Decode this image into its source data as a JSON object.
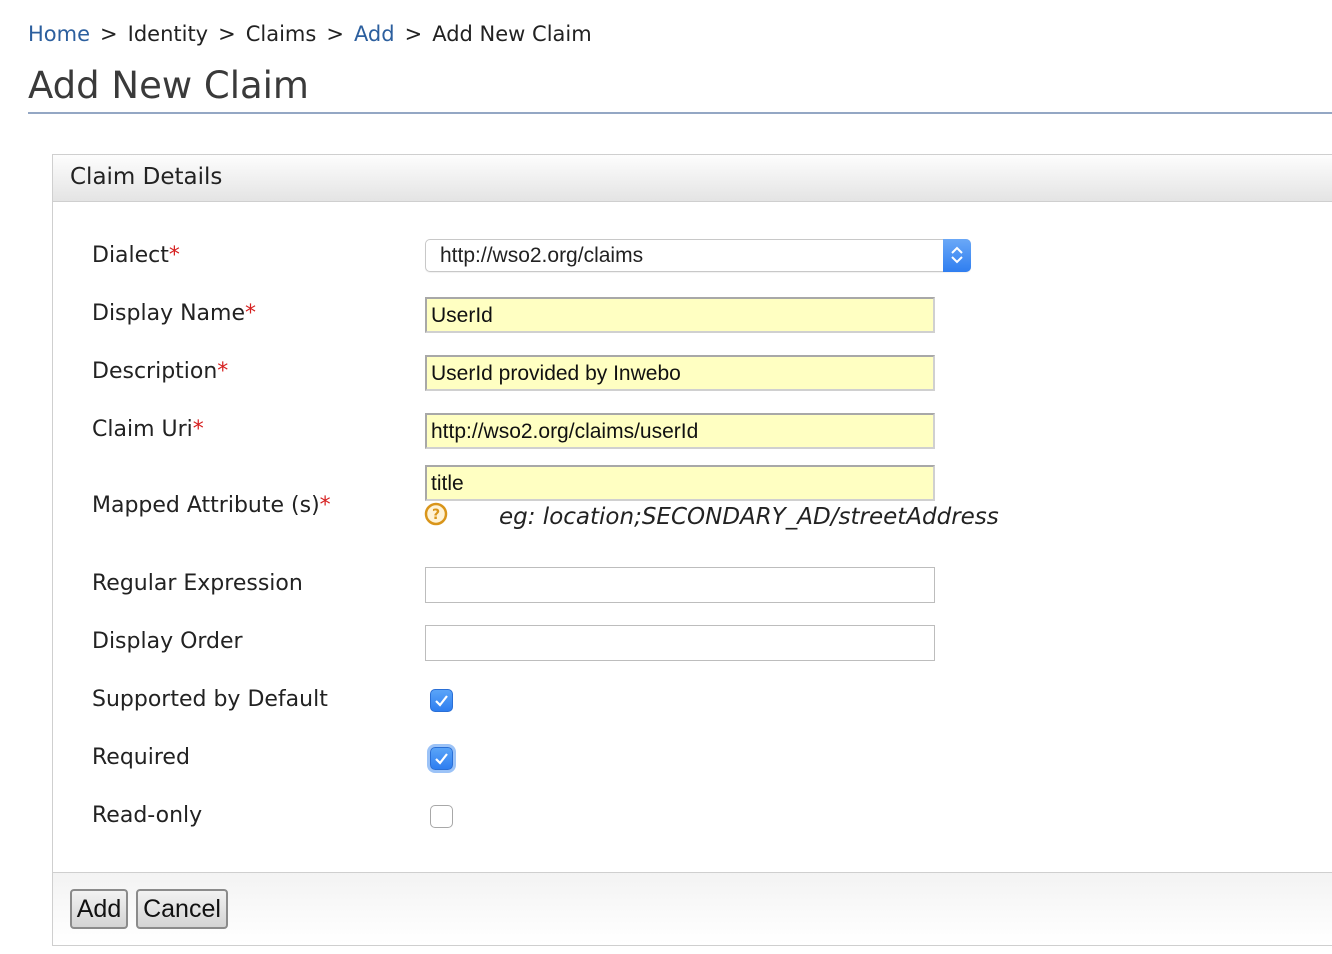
{
  "breadcrumb": {
    "home": "Home",
    "identity": "Identity",
    "claims": "Claims",
    "add": "Add",
    "current": "Add New Claim",
    "separator": ">"
  },
  "page_title": "Add New Claim",
  "panel": {
    "title": "Claim Details"
  },
  "required_marker": "*",
  "form": {
    "dialect": {
      "label": "Dialect",
      "value": "http://wso2.org/claims",
      "required": true
    },
    "display_name": {
      "label": "Display Name",
      "value": "UserId",
      "required": true
    },
    "description": {
      "label": "Description",
      "value": "UserId provided by Inwebo",
      "required": true
    },
    "claim_uri": {
      "label": "Claim Uri",
      "value": "http://wso2.org/claims/userId",
      "required": true
    },
    "mapped_attribute": {
      "label": "Mapped Attribute (s)",
      "value": "title",
      "required": true,
      "hint": "eg: location;SECONDARY_AD/streetAddress"
    },
    "regular_expression": {
      "label": "Regular Expression",
      "value": ""
    },
    "display_order": {
      "label": "Display Order",
      "value": ""
    },
    "supported_by_default": {
      "label": "Supported by Default",
      "checked": true
    },
    "required": {
      "label": "Required",
      "checked": true
    },
    "read_only": {
      "label": "Read-only",
      "checked": false
    }
  },
  "buttons": {
    "add": "Add",
    "cancel": "Cancel"
  },
  "colors": {
    "link": "#2c5f9e",
    "required_star": "#d62020",
    "filled_input_bg": "#ffffc2",
    "checkbox_on": "#2e7ef0"
  },
  "icons": {
    "help": "help-icon",
    "select_arrows": "chevron-updown-icon",
    "checkmark": "checkmark-icon"
  }
}
